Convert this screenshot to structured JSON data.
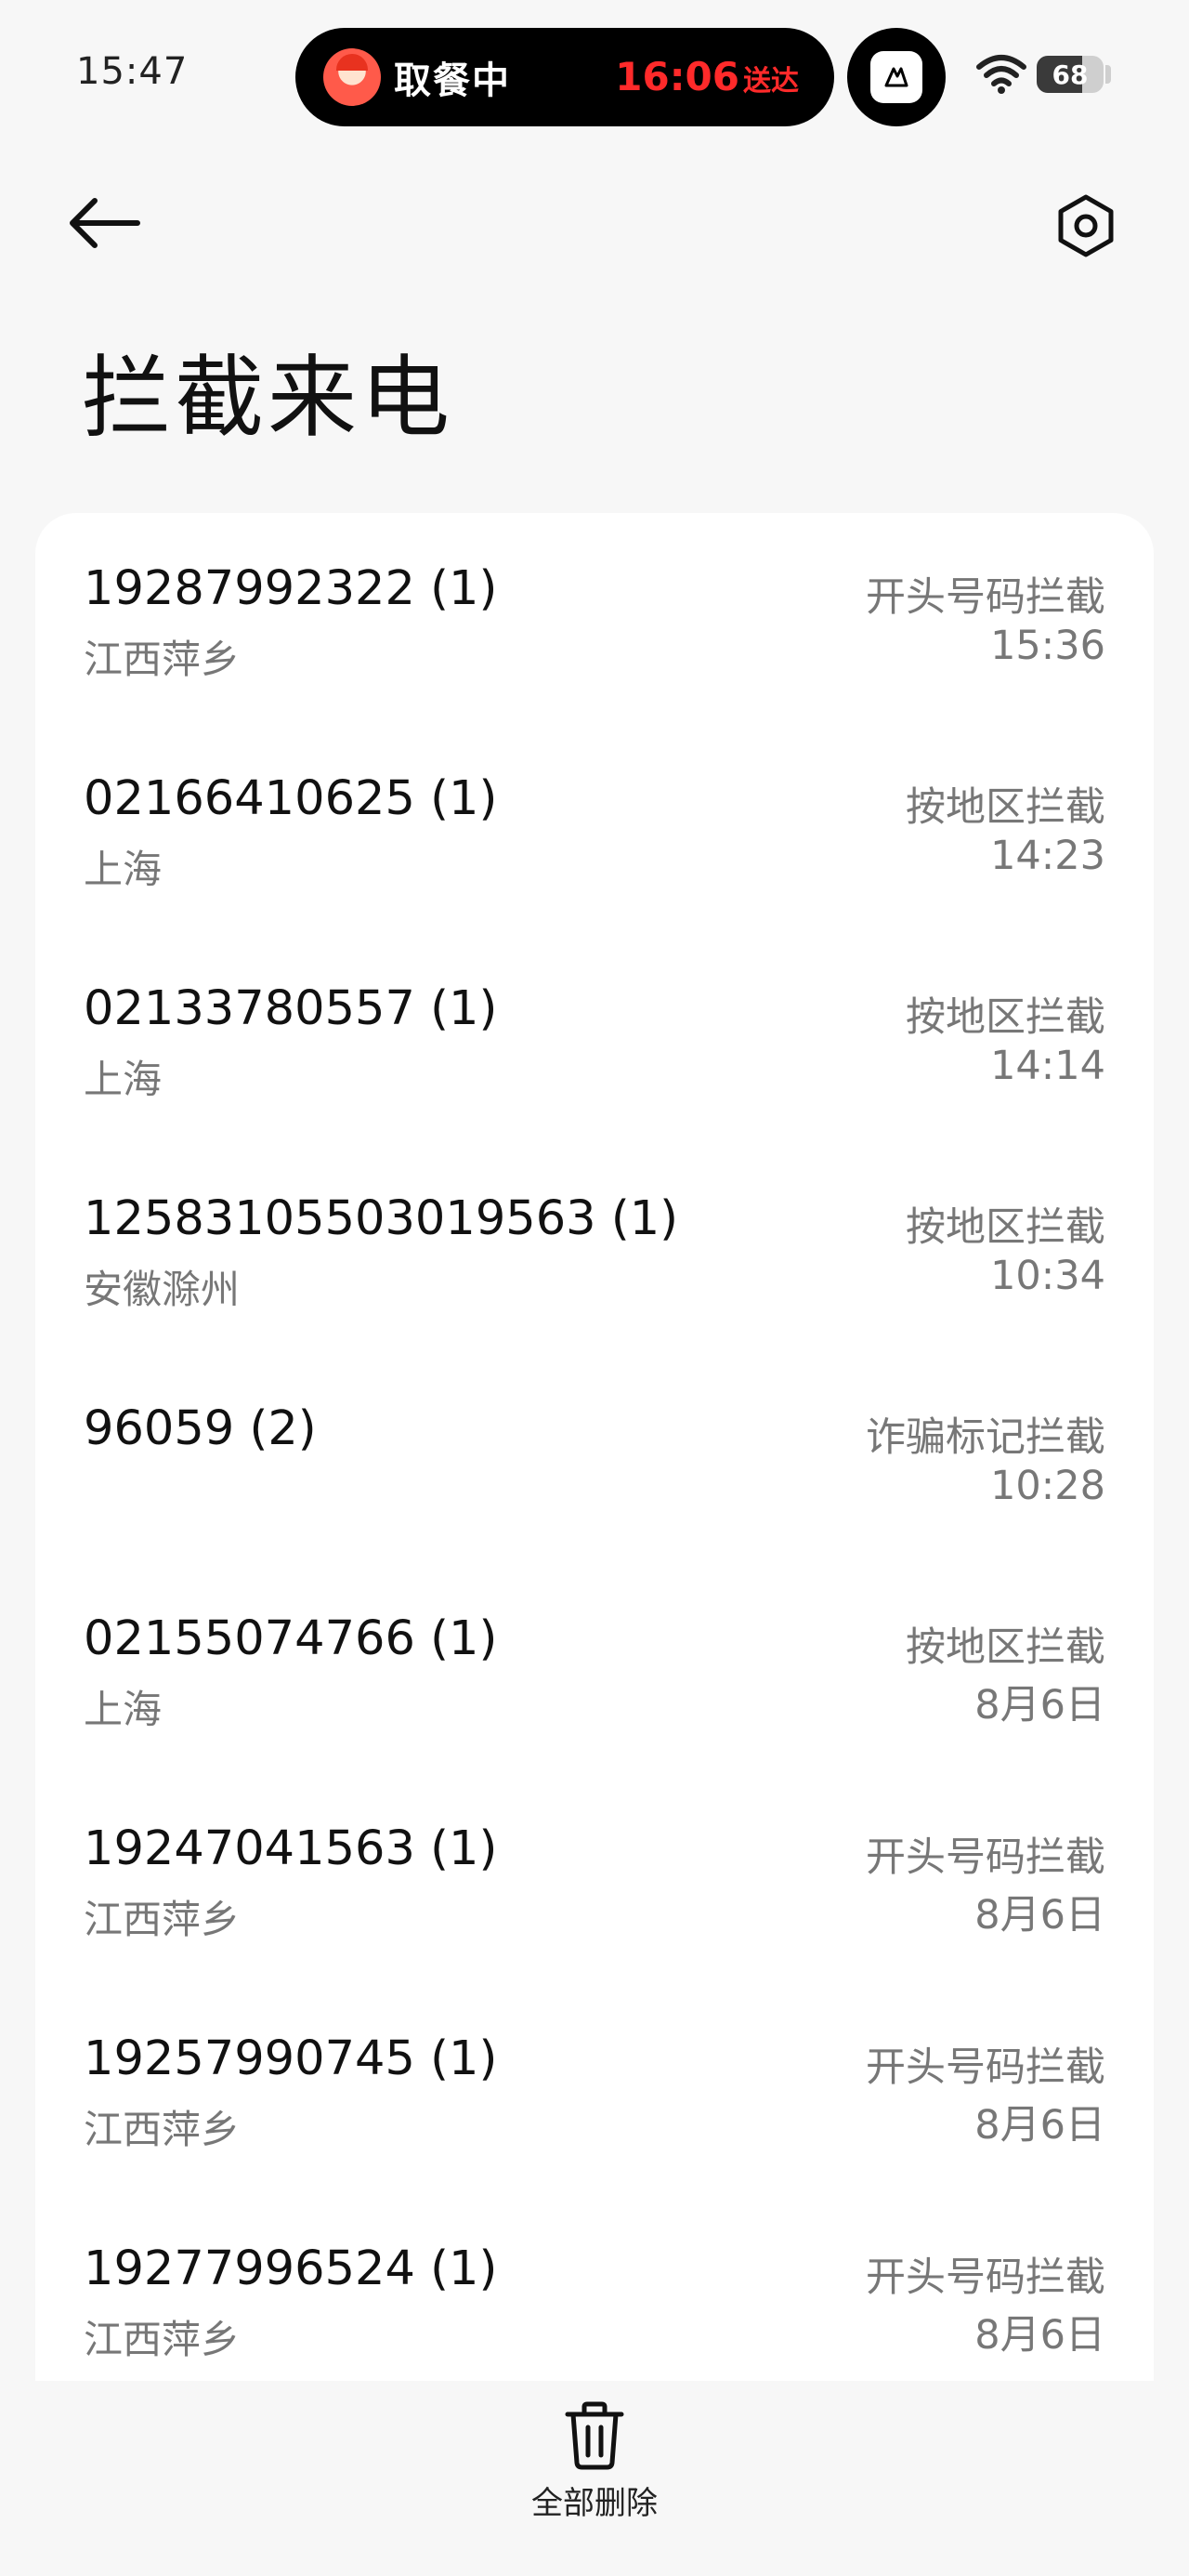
{
  "status_bar": {
    "time": "15:47",
    "live_activity": {
      "status": "取餐中",
      "eta_time": "16:06",
      "eta_label": "送达",
      "eta_color": "#ff2a2a"
    },
    "wifi_icon": "wifi-icon",
    "battery_level": "68",
    "battery_fraction": 0.68
  },
  "app_bar": {
    "back_icon": "arrow-left-icon",
    "settings_icon": "hexagon-settings-icon"
  },
  "page": {
    "title": "拦截来电"
  },
  "calls": [
    {
      "number": "19287992322 (1)",
      "location": "江西萍乡",
      "reason": "开头号码拦截",
      "time": "15:36"
    },
    {
      "number": "02166410625 (1)",
      "location": "上海",
      "reason": "按地区拦截",
      "time": "14:23"
    },
    {
      "number": "02133780557 (1)",
      "location": "上海",
      "reason": "按地区拦截",
      "time": "14:14"
    },
    {
      "number": "12583105503019563 (1)",
      "location": "安徽滁州",
      "reason": "按地区拦截",
      "time": "10:34"
    },
    {
      "number": "96059 (2)",
      "location": "",
      "reason": "诈骗标记拦截",
      "time": "10:28"
    },
    {
      "number": "02155074766 (1)",
      "location": "上海",
      "reason": "按地区拦截",
      "time": "8月6日"
    },
    {
      "number": "19247041563 (1)",
      "location": "江西萍乡",
      "reason": "开头号码拦截",
      "time": "8月6日"
    },
    {
      "number": "19257990745 (1)",
      "location": "江西萍乡",
      "reason": "开头号码拦截",
      "time": "8月6日"
    },
    {
      "number": "19277996524 (1)",
      "location": "江西萍乡",
      "reason": "开头号码拦截",
      "time": "8月6日"
    }
  ],
  "toolbar": {
    "delete_all_label": "全部删除",
    "delete_icon": "trash-icon"
  }
}
